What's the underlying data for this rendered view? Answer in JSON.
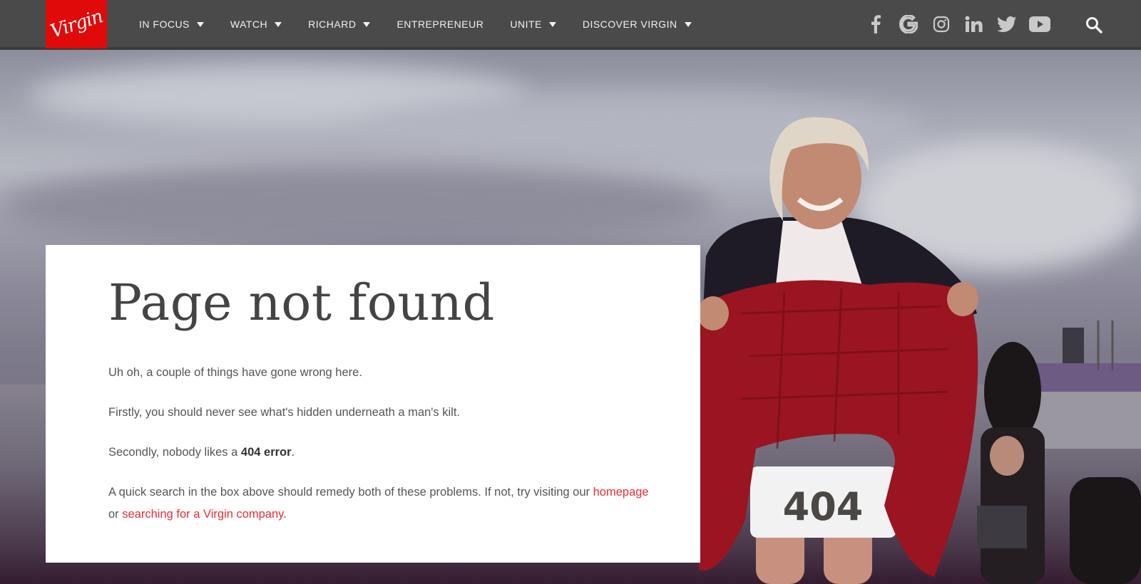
{
  "logo": {
    "text": "Virgin"
  },
  "nav": {
    "items": [
      {
        "label": "IN FOCUS",
        "dropdown": true
      },
      {
        "label": "WATCH",
        "dropdown": true
      },
      {
        "label": "RICHARD",
        "dropdown": true
      },
      {
        "label": "ENTREPRENEUR",
        "dropdown": false
      },
      {
        "label": "UNITE",
        "dropdown": true
      },
      {
        "label": "DISCOVER VIRGIN",
        "dropdown": true
      }
    ],
    "socials": [
      "facebook-icon",
      "google-icon",
      "instagram-icon",
      "linkedin-icon",
      "twitter-icon",
      "youtube-icon"
    ],
    "search_icon": "search-icon"
  },
  "card": {
    "title": "Page not found",
    "p1": "Uh oh, a couple of things have gone wrong here.",
    "p2": "Firstly, you should never see what's hidden underneath a man's kilt.",
    "p3_before": "Secondly, nobody likes a ",
    "p3_strong": "404 error",
    "p3_after": ".",
    "p4_before": "A quick search in the box above should remedy both of these problems. If not, try visiting our ",
    "p4_link1": "homepage",
    "p4_mid": " or ",
    "p4_link2": "searching for a Virgin company",
    "p4_after": "."
  },
  "hero": {
    "shorts_text": "404"
  },
  "colors": {
    "brand_red": "#e10a0a",
    "link_red": "#e62e35",
    "nav_bg": "#4a4a4a",
    "kilt_red": "#9a1421"
  }
}
